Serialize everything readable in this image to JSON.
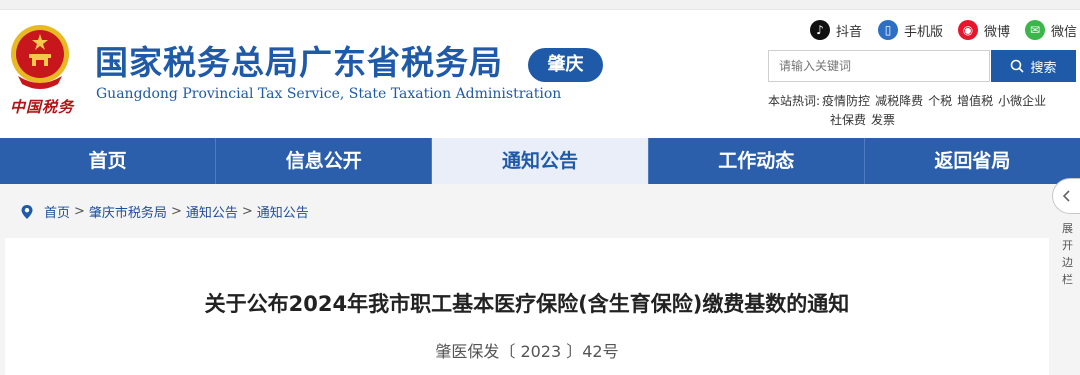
{
  "header": {
    "title": "国家税务总局广东省税务局",
    "subtitle": "Guangdong Provincial Tax Service, State Taxation Administration",
    "city_badge": "肇庆",
    "calligraphy": "中国税务"
  },
  "social": {
    "douyin": "抖音",
    "mobile": "手机版",
    "weibo": "微博",
    "wechat": "微信"
  },
  "search": {
    "placeholder": "请输入关键词",
    "button_label": "搜索"
  },
  "hot_words": {
    "label": "本站热词:",
    "items": [
      "疫情防控",
      "减税降费",
      "个税",
      "增值税",
      "小微企业",
      "社保费",
      "发票"
    ]
  },
  "nav": {
    "items": [
      "首页",
      "信息公开",
      "通知公告",
      "工作动态",
      "返回省局"
    ],
    "active_index": 2
  },
  "breadcrumb": {
    "items": [
      "首页",
      "肇庆市税务局",
      "通知公告",
      "通知公告"
    ],
    "separator": ">"
  },
  "article": {
    "title": "关于公布2024年我市职工基本医疗保险(含生育保险)缴费基数的通知",
    "doc_number": "肇医保发〔 2023 〕42号"
  },
  "sidebar_toggle": {
    "label": "展开边栏"
  },
  "colors": {
    "brand_blue": "#1f5aa8",
    "nav_blue": "#2c5fab",
    "nav_active_bg": "#e9eef8",
    "emblem_red": "#c8161d",
    "emblem_gold": "#e8b923"
  }
}
